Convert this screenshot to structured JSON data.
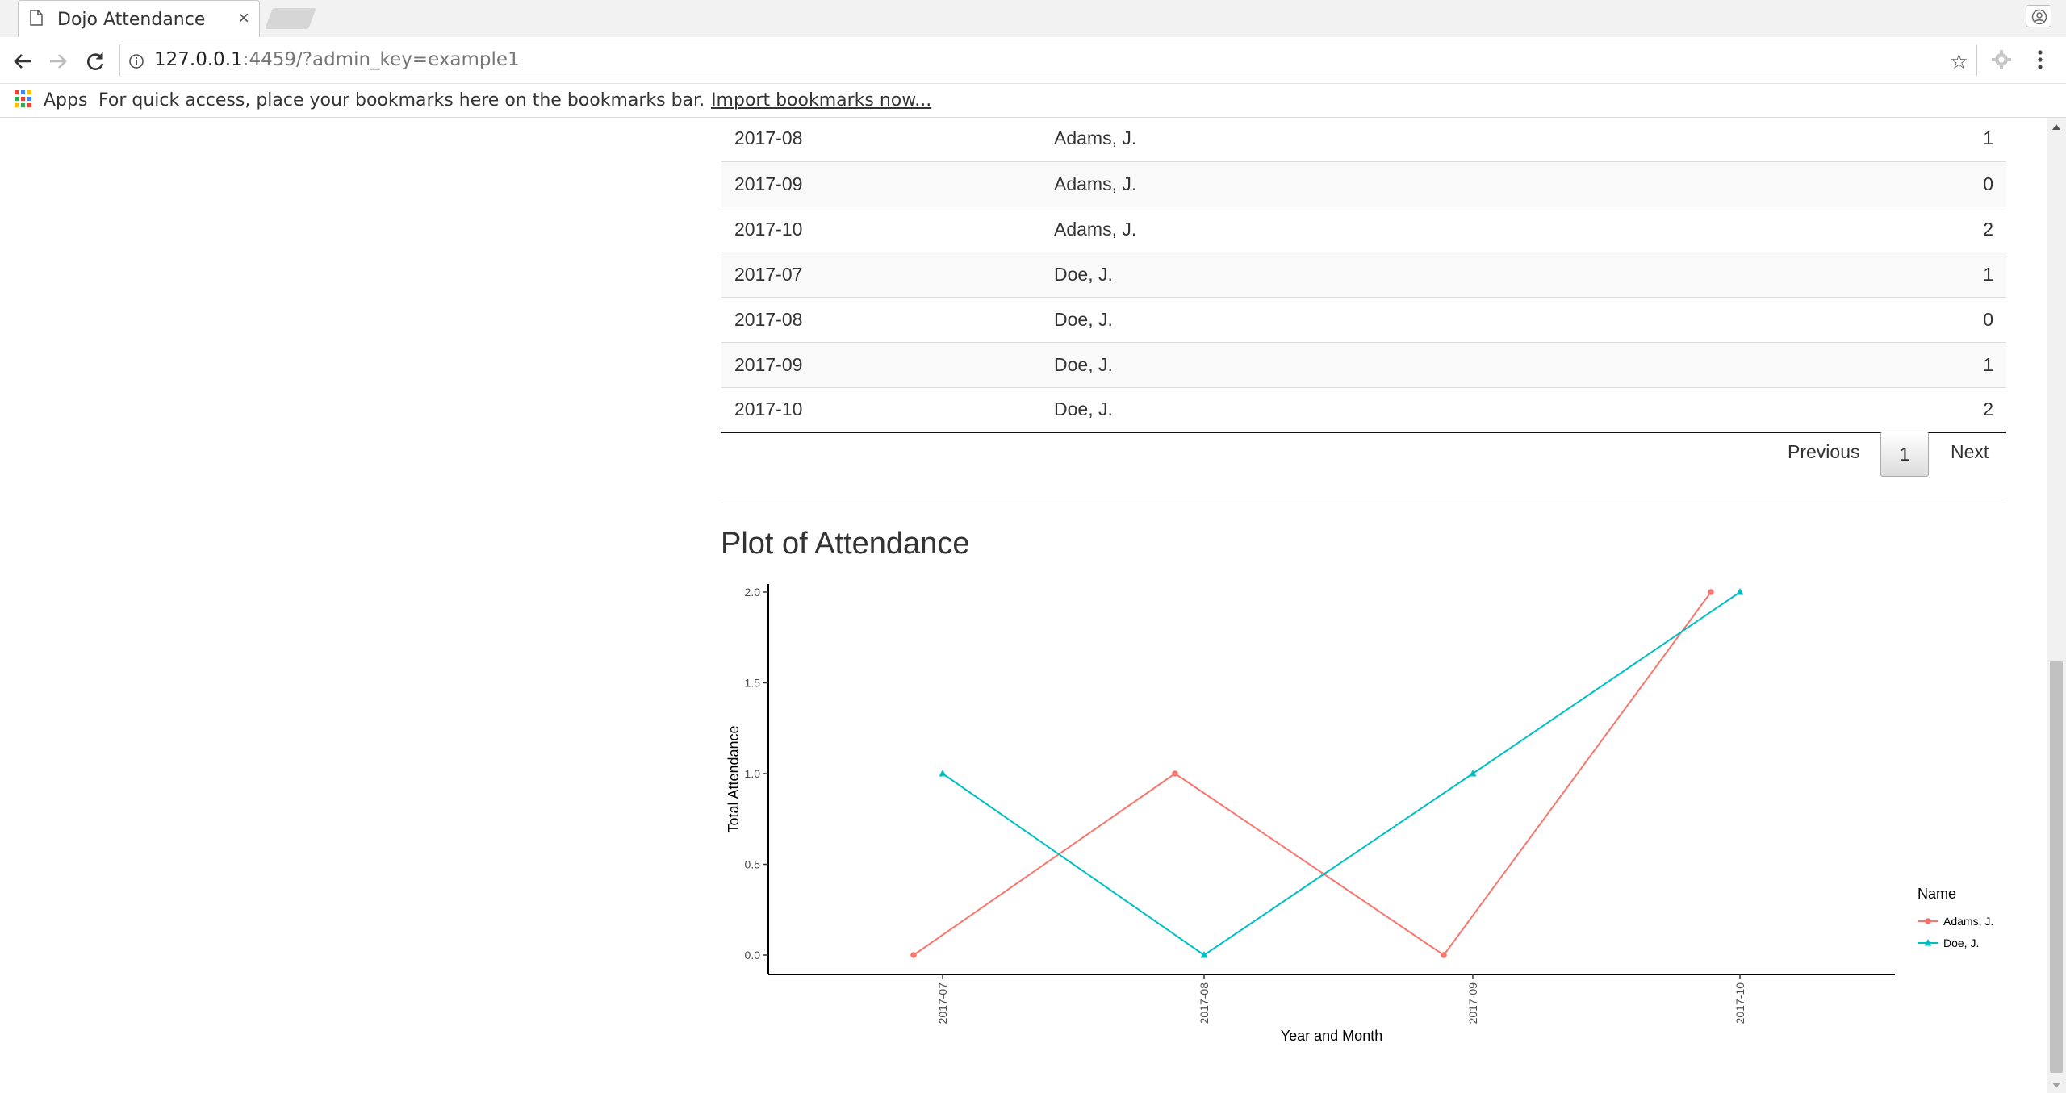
{
  "browser": {
    "tab_title": "Dojo Attendance",
    "tab_close": "×",
    "url_host": "127.0.0.1",
    "url_rest": ":4459/?admin_key=example1",
    "bookmarks_apps_label": "Apps",
    "bookmarks_hint": "For quick access, place your bookmarks here on the bookmarks bar.",
    "bookmarks_import_link": "Import bookmarks now..."
  },
  "table": {
    "rows": [
      {
        "month": "2017-08",
        "name": "Adams, J.",
        "count": "1"
      },
      {
        "month": "2017-09",
        "name": "Adams, J.",
        "count": "0"
      },
      {
        "month": "2017-10",
        "name": "Adams, J.",
        "count": "2"
      },
      {
        "month": "2017-07",
        "name": "Doe, J.",
        "count": "1"
      },
      {
        "month": "2017-08",
        "name": "Doe, J.",
        "count": "0"
      },
      {
        "month": "2017-09",
        "name": "Doe, J.",
        "count": "1"
      },
      {
        "month": "2017-10",
        "name": "Doe, J.",
        "count": "2"
      }
    ]
  },
  "pagination": {
    "previous_label": "Previous",
    "current_page": "1",
    "next_label": "Next"
  },
  "plot_section": {
    "heading": "Plot of Attendance"
  },
  "chart_data": {
    "type": "line",
    "title": "",
    "xlabel": "Year and Month",
    "ylabel": "Total Attendance",
    "categories": [
      "2017-07",
      "2017-08",
      "2017-09",
      "2017-10"
    ],
    "yticks": [
      "0.0",
      "0.5",
      "1.0",
      "1.5",
      "2.0"
    ],
    "ylim": [
      0,
      2
    ],
    "grid": false,
    "legend_title": "Name",
    "legend_position": "right",
    "series": [
      {
        "name": "Adams, J.",
        "color": "#F8766D",
        "marker": "circle",
        "values": [
          0,
          1,
          0,
          2
        ]
      },
      {
        "name": "Doe, J.",
        "color": "#00BFC4",
        "marker": "triangle",
        "values": [
          1,
          0,
          1,
          2
        ]
      }
    ]
  }
}
